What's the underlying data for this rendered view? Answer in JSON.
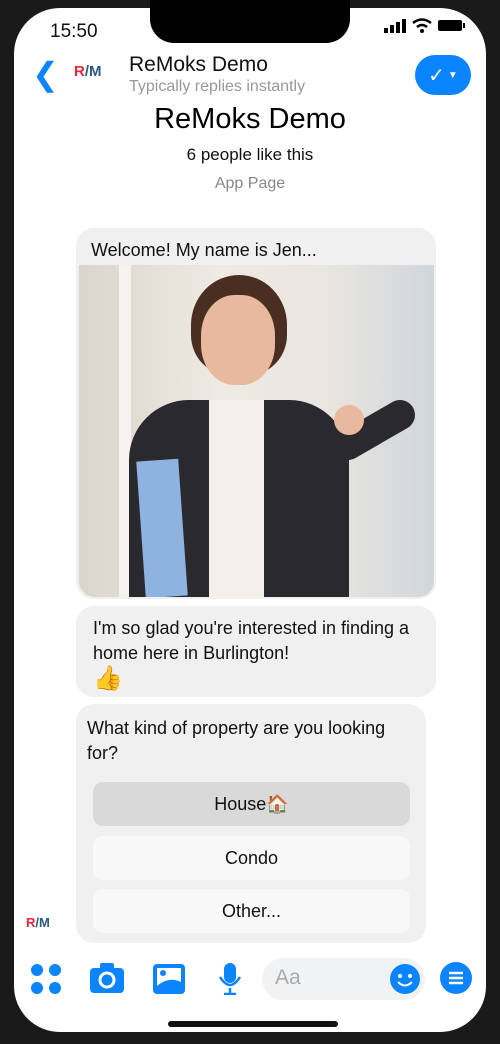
{
  "status_bar": {
    "time": "15:50"
  },
  "header": {
    "title": "ReMoks Demo",
    "subtitle": "Typically replies instantly",
    "logo": {
      "r": "R",
      "slash": "/",
      "m": "M"
    }
  },
  "profile": {
    "name": "ReMoks Demo",
    "likes": "6 people like this",
    "category": "App Page"
  },
  "messages": [
    {
      "text": "Welcome! My name is Jen..."
    },
    {
      "text": "I'm so glad you're interested in finding a home here in Burlington!",
      "emoji": "👍"
    },
    {
      "text": "What kind of property are you looking for?"
    }
  ],
  "quick_replies": [
    {
      "label": "House🏠"
    },
    {
      "label": "Condo"
    },
    {
      "label": "Other..."
    }
  ],
  "composer": {
    "placeholder": "Aa"
  },
  "colors": {
    "accent": "#0a84ff",
    "bubble": "#f0f0f0"
  }
}
